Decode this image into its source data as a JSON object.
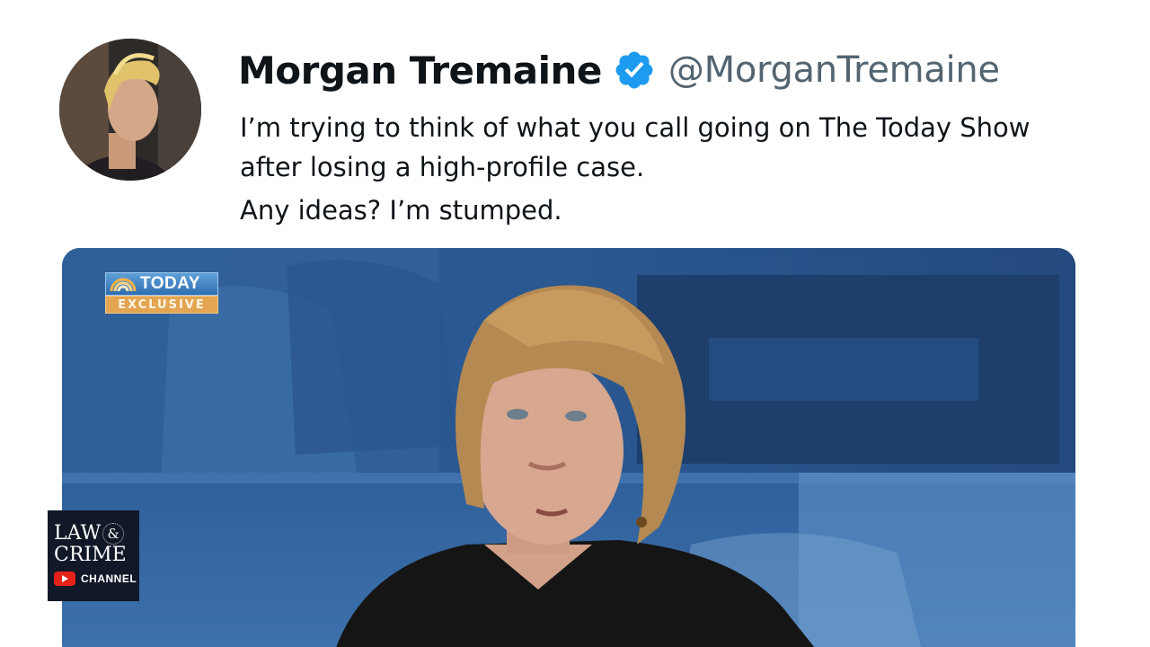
{
  "tweet": {
    "author": {
      "display_name": "Morgan Tremaine",
      "handle": "@MorganTremaine",
      "verified": true,
      "avatar_icon": "profile-photo"
    },
    "text_paragraphs": [
      "I’m trying to think of what you call going on The Today Show after losing a high-profile case.",
      "Any ideas? I’m stumped."
    ],
    "media": {
      "overlay_badge": {
        "top": "TODAY",
        "bottom": "EXCLUSIVE"
      }
    }
  },
  "watermark": {
    "line1": "LAW",
    "amp": "&",
    "line2": "CRIME",
    "channel": "CHANNEL",
    "icon": "youtube-icon"
  },
  "colors": {
    "verified_blue": "#1d9bf0",
    "handle_gray": "#536471",
    "text_dark": "#0f1419"
  }
}
